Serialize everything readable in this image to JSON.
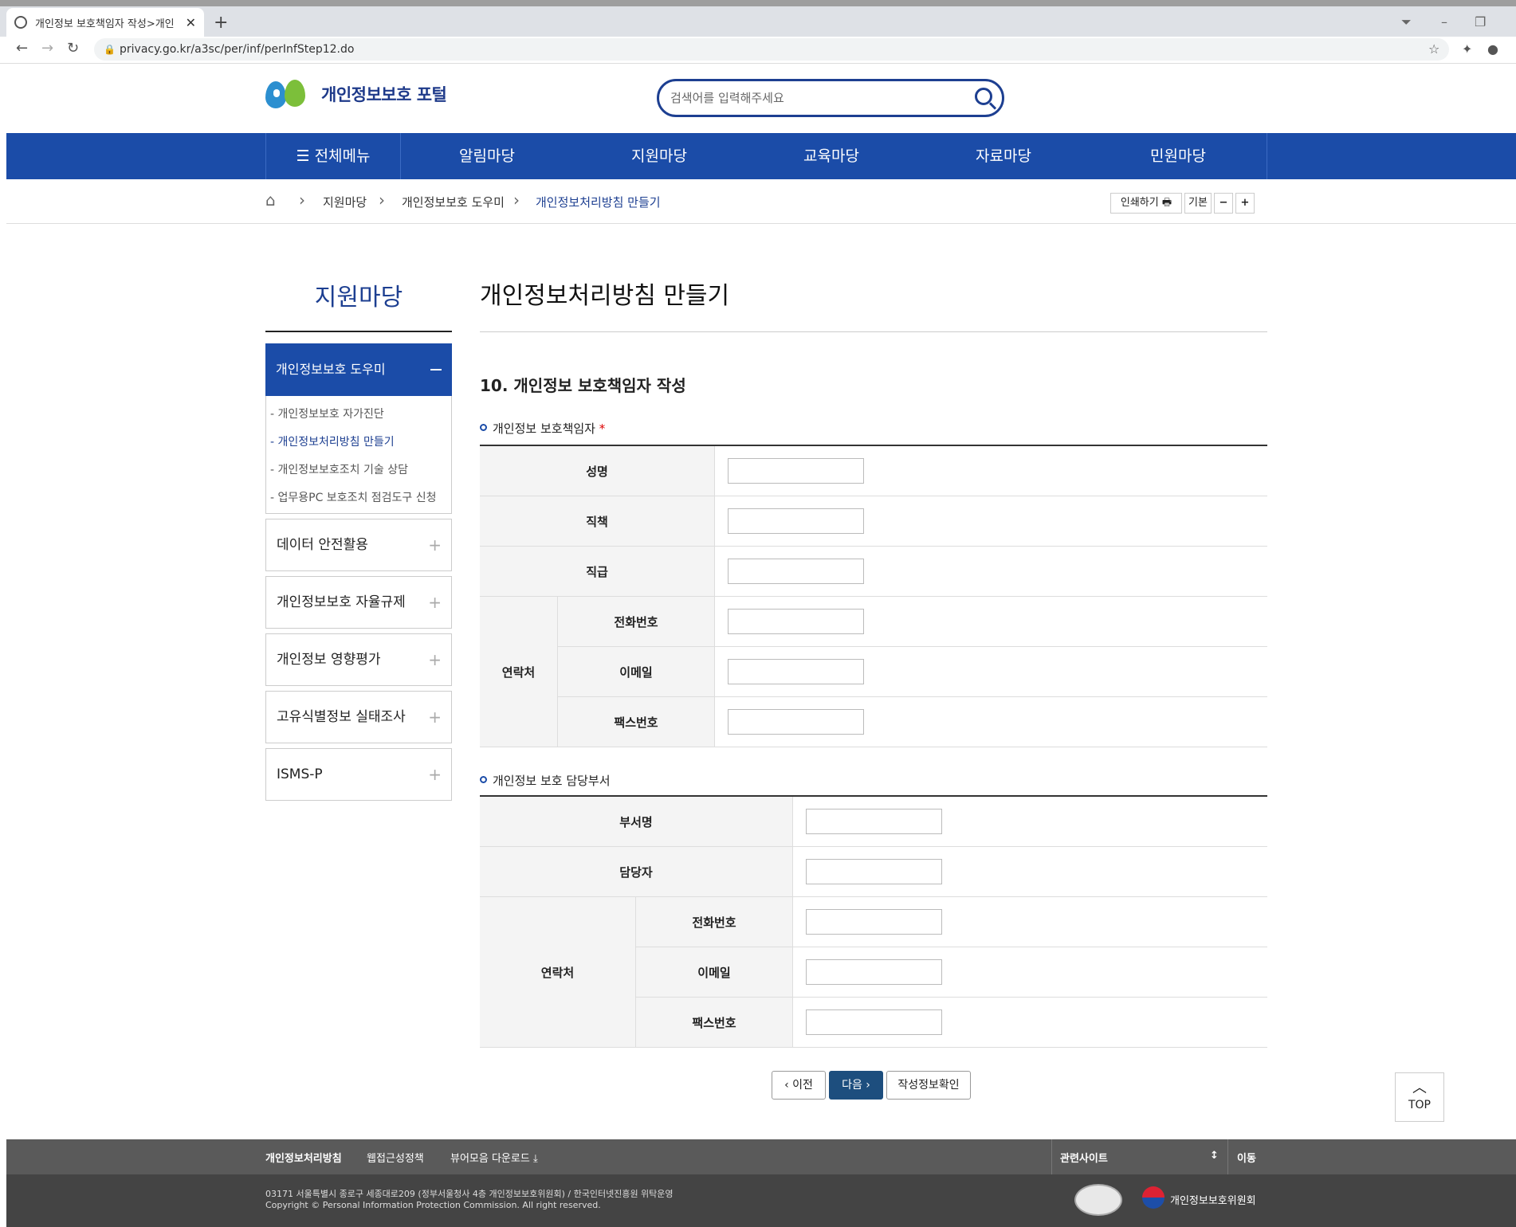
{
  "browser": {
    "tab_title": "개인정보 보호책임자 작성>개인",
    "url": "privacy.go.kr/a3sc/per/inf/perInfStep12.do"
  },
  "header": {
    "logo_text": "개인정보보호 포털",
    "search_placeholder": "검색어를 입력해주세요"
  },
  "gnb": {
    "all_menu": "전체메뉴",
    "items": [
      "알림마당",
      "지원마당",
      "교육마당",
      "자료마당",
      "민원마당"
    ]
  },
  "breadcrumb": {
    "items": [
      "지원마당",
      "개인정보보호 도우미",
      "개인정보처리방침 만들기"
    ],
    "print": "인쇄하기",
    "default": "기본",
    "minus": "−",
    "plus": "+"
  },
  "sidebar": {
    "title": "지원마당",
    "active": "개인정보보호 도우미",
    "sub": [
      "- 개인정보보호 자가진단",
      "- 개인정보처리방침 만들기",
      "- 개인정보보호조치 기술 상담",
      "- 업무용PC 보호조치 점검도구 신청"
    ],
    "boxes": [
      "데이터 안전활용",
      "개인정보보호 자율규제",
      "개인정보 영향평가",
      "고유식별정보 실태조사",
      "ISMS-P"
    ]
  },
  "content": {
    "title": "개인정보처리방침 만들기",
    "section_title": "10. 개인정보 보호책임자 작성",
    "group1": {
      "heading": "개인정보 보호책임자",
      "required": "*",
      "labels": [
        "성명",
        "직책",
        "직급"
      ],
      "contact": "연락처",
      "contact_labels": [
        "전화번호",
        "이메일",
        "팩스번호"
      ]
    },
    "group2": {
      "heading": "개인정보 보호 담당부서",
      "labels": [
        "부서명",
        "담당자"
      ],
      "contact": "연락처",
      "contact_labels": [
        "전화번호",
        "이메일",
        "팩스번호"
      ]
    },
    "buttons": {
      "prev": "‹ 이전",
      "next": "다음 ›",
      "review": "작성정보확인"
    },
    "top": "TOP"
  },
  "footer": {
    "links": [
      "개인정보처리방침",
      "웹접근성정책",
      "뷰어모음 다운로드"
    ],
    "related": "관련사이트",
    "go": "이동",
    "address": "03171 서울특별시 종로구 세종대로209 (정부서울청사 4층 개인정보보호위원회) / 한국인터넷진흥원 위탁운영",
    "copyright": "Copyright © Personal Information Protection Commission. All right reserved.",
    "agency": "개인정보보호위원회"
  }
}
